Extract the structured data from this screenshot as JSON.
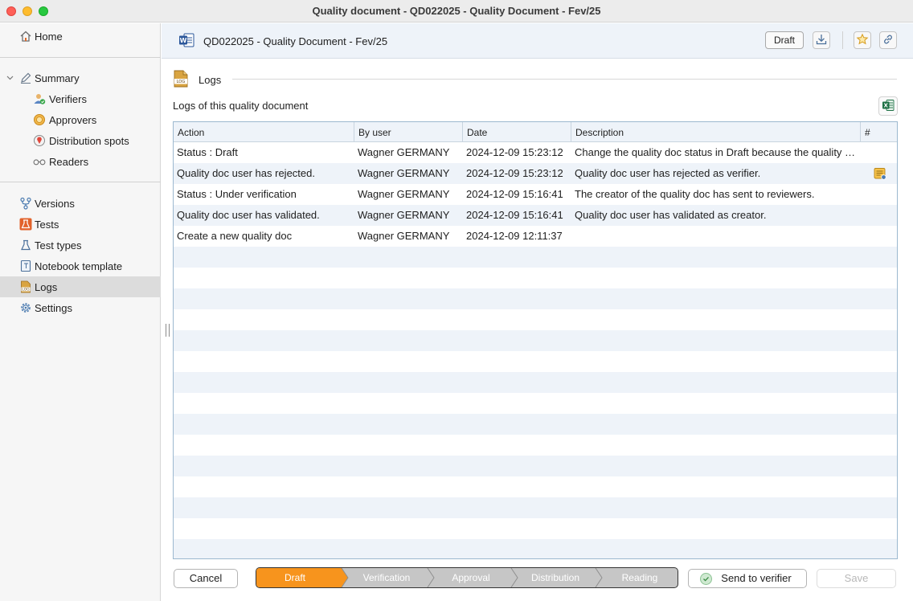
{
  "window": {
    "title": "Quality document - QD022025 - Quality Document - Fev/25"
  },
  "sidebar": {
    "home": "Home",
    "summary": "Summary",
    "summary_children": [
      "Verifiers",
      "Approvers",
      "Distribution spots",
      "Readers"
    ],
    "items": [
      "Versions",
      "Tests",
      "Test types",
      "Notebook template",
      "Logs",
      "Settings"
    ],
    "selected": "Logs"
  },
  "header": {
    "doc_title": "QD022025 - Quality Document - Fev/25",
    "status": "Draft",
    "icons": [
      "download-icon",
      "star-icon",
      "link-icon"
    ]
  },
  "section": {
    "title": "Logs",
    "subtitle": "Logs of this quality document"
  },
  "table": {
    "columns": [
      "Action",
      "By user",
      "Date",
      "Description",
      "#"
    ],
    "rows": [
      {
        "action": "Status : Draft",
        "user": "Wagner GERMANY",
        "date": "2024-12-09 15:23:12",
        "description": "Change the quality doc status in Draft because the quality doc user has rejected as verifier.",
        "note": false
      },
      {
        "action": "Quality doc user has rejected.",
        "user": "Wagner GERMANY",
        "date": "2024-12-09 15:23:12",
        "description": "Quality doc user has rejected as verifier.",
        "note": true
      },
      {
        "action": "Status : Under verification",
        "user": "Wagner GERMANY",
        "date": "2024-12-09 15:16:41",
        "description": "The creator of the quality doc has sent to reviewers.",
        "note": false
      },
      {
        "action": "Quality doc user has validated.",
        "user": "Wagner GERMANY",
        "date": "2024-12-09 15:16:41",
        "description": "Quality doc user has validated as creator.",
        "note": false
      },
      {
        "action": "Create a new quality doc",
        "user": "Wagner GERMANY",
        "date": "2024-12-09 12:11:37",
        "description": "",
        "note": false
      }
    ]
  },
  "footer": {
    "cancel": "Cancel",
    "stages": [
      "Draft",
      "Verification",
      "Approval",
      "Distribution",
      "Reading"
    ],
    "active_stage": "Draft",
    "send": "Send to verifier",
    "save": "Save"
  },
  "colors": {
    "active_stage": "#f7941d",
    "inactive_stage": "#c6c6c6",
    "header_bg": "#eef3f9",
    "selection": "#dcdcdc"
  }
}
